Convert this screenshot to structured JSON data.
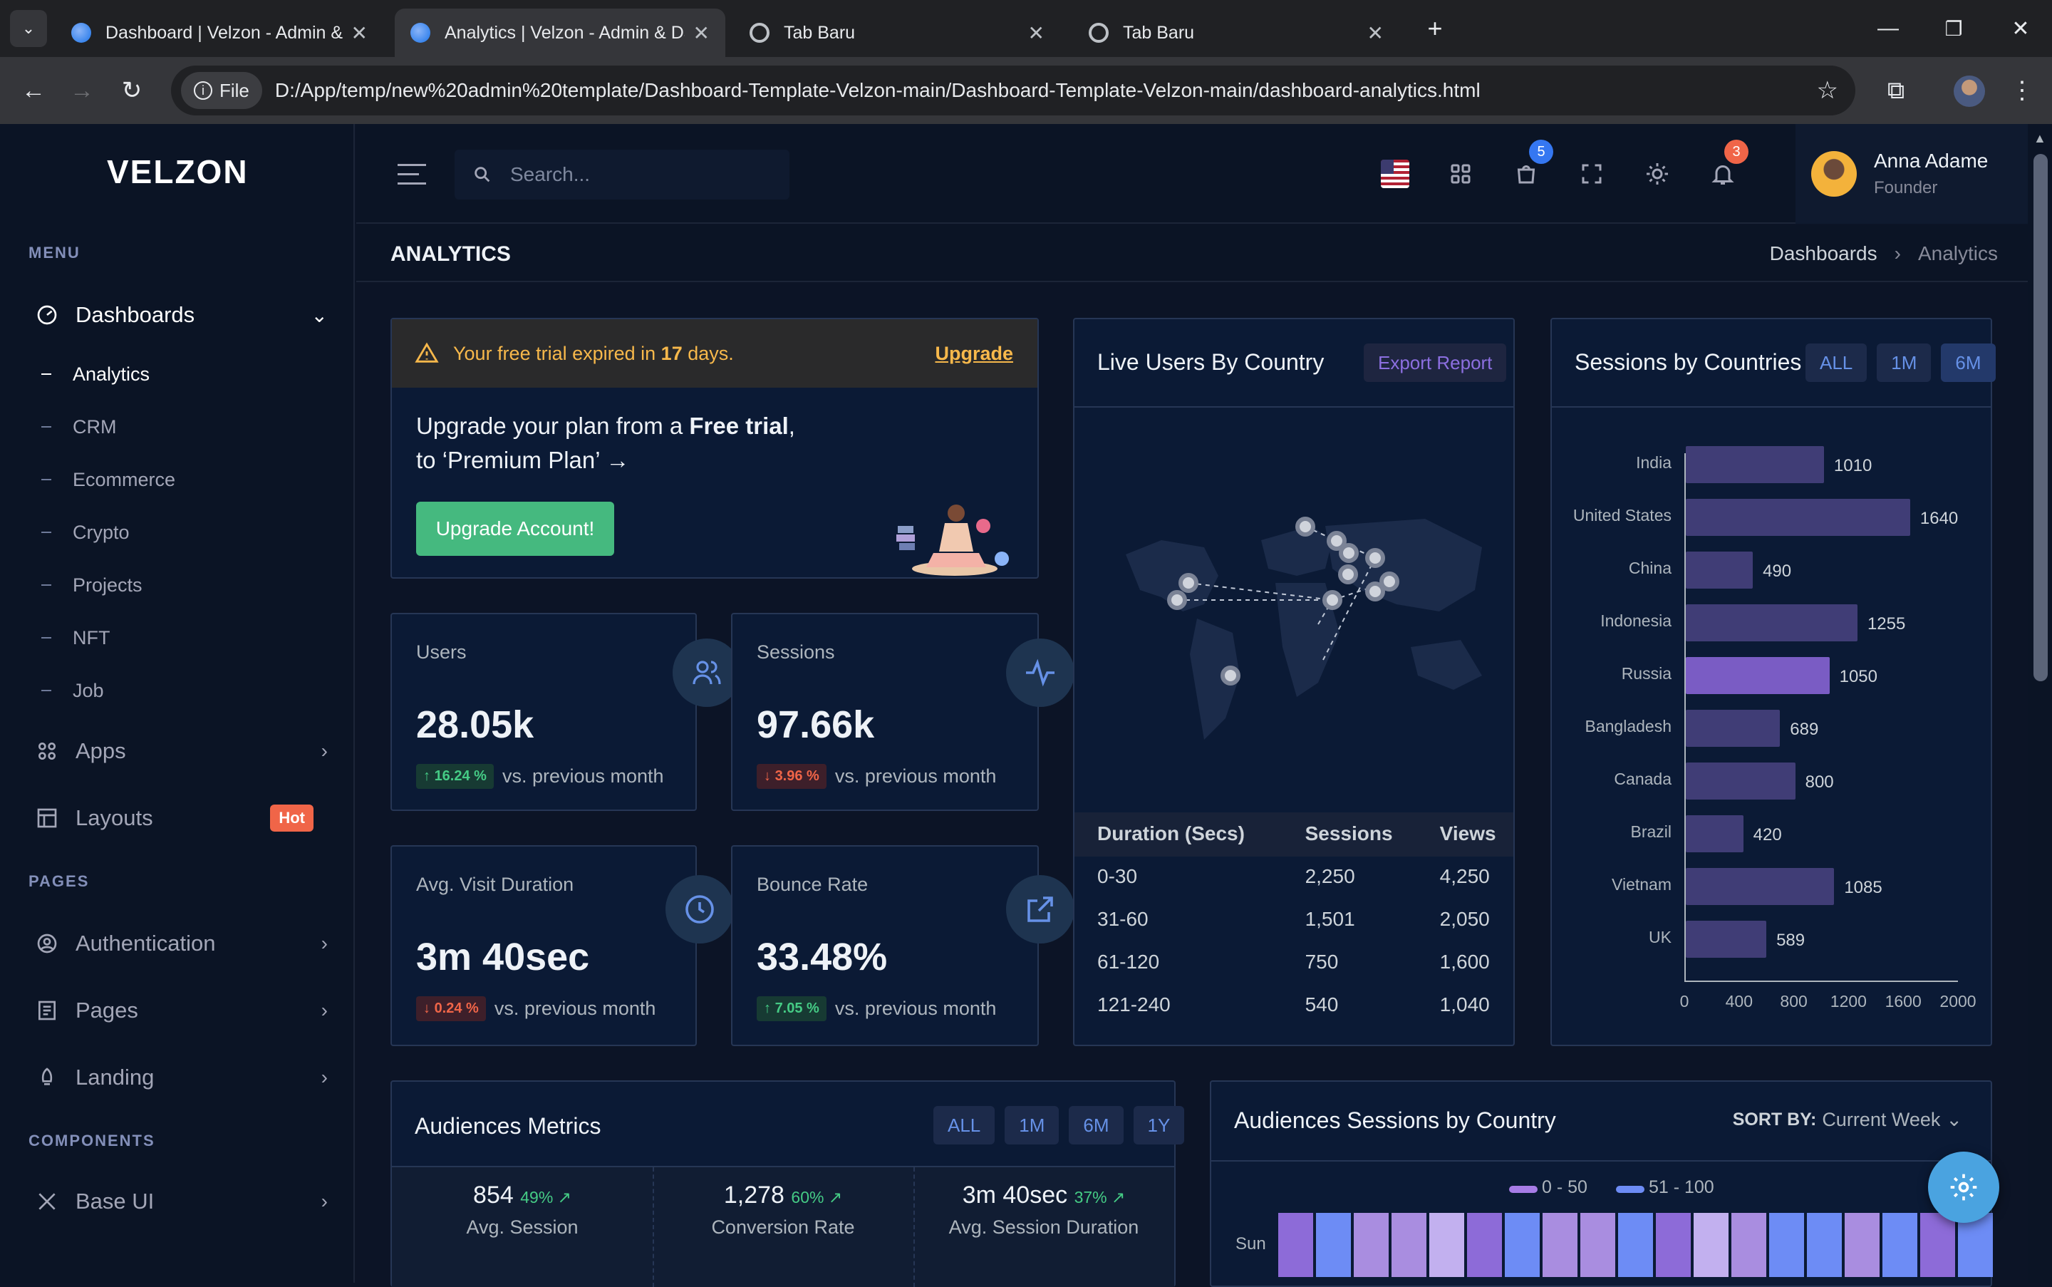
{
  "browser": {
    "tabs": [
      {
        "title": "Dashboard | Velzon - Admin & Dashboard Template",
        "active": false
      },
      {
        "title": "Analytics | Velzon - Admin & Dashboard Template",
        "active": true
      },
      {
        "title": "Tab Baru",
        "active": false
      },
      {
        "title": "Tab Baru",
        "active": false
      }
    ],
    "file_chip": "File",
    "url": "D:/App/temp/new%20admin%20template/Dashboard-Template-Velzon-main/Dashboard-Template-Velzon-main/dashboard-analytics.html"
  },
  "sidebar": {
    "logo": "VELZON",
    "menu_title": "MENU",
    "dashboards_label": "Dashboards",
    "sub_items": [
      "Analytics",
      "CRM",
      "Ecommerce",
      "Crypto",
      "Projects",
      "NFT",
      "Job"
    ],
    "apps_label": "Apps",
    "layouts_label": "Layouts",
    "layouts_badge": "Hot",
    "pages_title": "PAGES",
    "authentication_label": "Authentication",
    "pages_label": "Pages",
    "landing_label": "Landing",
    "components_title": "COMPONENTS",
    "baseui_label": "Base UI"
  },
  "topbar": {
    "search_placeholder": "Search...",
    "cart_count": "5",
    "notif_count": "3",
    "user_name": "Anna Adame",
    "user_role": "Founder"
  },
  "page": {
    "title": "ANALYTICS",
    "breadcrumb_parent": "Dashboards",
    "breadcrumb_current": "Analytics"
  },
  "trial": {
    "notice_prefix": "Your free trial expired in ",
    "notice_days": "17",
    "notice_suffix": " days.",
    "upgrade_link": "Upgrade",
    "line1_prefix": "Upgrade your plan from a ",
    "line1_bold": "Free trial",
    "line1_suffix": ",",
    "line2": "to ‘Premium Plan’ →",
    "button": "Upgrade Account!"
  },
  "kpis": [
    {
      "label": "Users",
      "value": "28.05k",
      "change": "16.24 %",
      "dir": "up",
      "foot": "vs. previous month"
    },
    {
      "label": "Sessions",
      "value": "97.66k",
      "change": "3.96 %",
      "dir": "down",
      "foot": "vs. previous month"
    },
    {
      "label": "Avg. Visit Duration",
      "value": "3m 40sec",
      "change": "0.24 %",
      "dir": "down",
      "foot": "vs. previous month"
    },
    {
      "label": "Bounce Rate",
      "value": "33.48%",
      "change": "7.05 %",
      "dir": "up",
      "foot": "vs. previous month"
    }
  ],
  "live_users": {
    "title": "Live Users By Country",
    "export": "Export Report",
    "columns": [
      "Duration (Secs)",
      "Sessions",
      "Views"
    ],
    "rows": [
      [
        "0-30",
        "2,250",
        "4,250"
      ],
      [
        "31-60",
        "1,501",
        "2,050"
      ],
      [
        "61-120",
        "750",
        "1,600"
      ],
      [
        "121-240",
        "540",
        "1,040"
      ]
    ]
  },
  "sessions_by_country": {
    "title": "Sessions by Countries",
    "filters": [
      "ALL",
      "1M",
      "6M"
    ],
    "active_filter": "6M"
  },
  "chart_data": {
    "type": "bar",
    "orientation": "horizontal",
    "categories": [
      "India",
      "United States",
      "China",
      "Indonesia",
      "Russia",
      "Bangladesh",
      "Canada",
      "Brazil",
      "Vietnam",
      "UK"
    ],
    "values": [
      1010,
      1640,
      490,
      1255,
      1050,
      689,
      800,
      420,
      1085,
      589
    ],
    "highlight": "Russia",
    "xticks": [
      "0",
      "400",
      "800",
      "1200",
      "1600",
      "2000"
    ],
    "xlim": [
      0,
      2000
    ],
    "bar_color": "#403d76",
    "highlight_color": "#7a5cc4"
  },
  "audience": {
    "title": "Audiences Metrics",
    "filters": [
      "ALL",
      "1M",
      "6M",
      "1Y"
    ],
    "metrics": [
      {
        "value": "854",
        "pct": "49%",
        "label": "Avg. Session"
      },
      {
        "value": "1,278",
        "pct": "60%",
        "label": "Conversion Rate"
      },
      {
        "value": "3m 40sec",
        "pct": "37%",
        "label": "Avg. Session Duration"
      }
    ]
  },
  "audience_sessions": {
    "title": "Audiences Sessions by Country",
    "sort_label": "SORT BY:",
    "sort_value": "Current Week",
    "legend": [
      "0 - 50",
      "51 - 100"
    ],
    "row_label": "Sun"
  }
}
